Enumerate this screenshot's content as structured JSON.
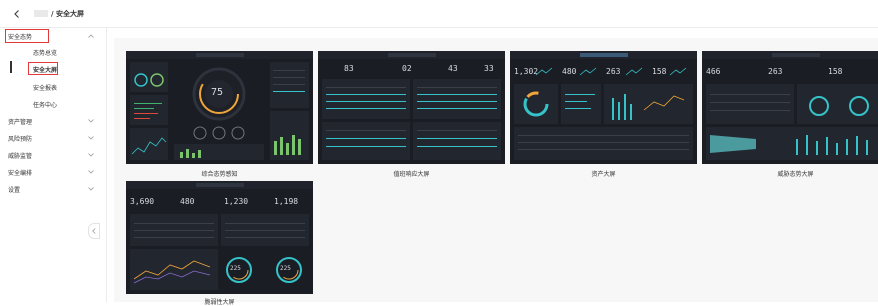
{
  "breadcrumb": {
    "current": "/ 安全大屏"
  },
  "sidebar": {
    "items": [
      {
        "label": "安全态势",
        "expandable": true,
        "expanded": true,
        "selected": true
      },
      {
        "label": "态势总览",
        "sub": true
      },
      {
        "label": "安全大屏",
        "sub": true,
        "active": true
      },
      {
        "label": "安全报表",
        "sub": true
      },
      {
        "label": "任务中心",
        "sub": true
      },
      {
        "label": "资产管理",
        "expandable": true
      },
      {
        "label": "风险预防",
        "expandable": true
      },
      {
        "label": "威胁监管",
        "expandable": true
      },
      {
        "label": "安全编排",
        "expandable": true
      },
      {
        "label": "设置",
        "expandable": true
      }
    ]
  },
  "screens": [
    {
      "label": "综合态势感知",
      "center_value": "75"
    },
    {
      "label": "值班响应大屏",
      "stats": [
        "83",
        "02",
        "43",
        "33"
      ]
    },
    {
      "label": "资产大屏",
      "stats": [
        "1,302",
        "480",
        "263",
        "158"
      ]
    },
    {
      "label": "威胁态势大屏",
      "stats": [
        "466",
        "263",
        "158"
      ]
    },
    {
      "label": "脆弱性大屏",
      "stats": [
        "3,690",
        "480",
        "1,230",
        "1,198"
      ],
      "gauges": [
        "225",
        "225"
      ]
    }
  ],
  "colors": {
    "accent_red": "#e23a3a",
    "teal": "#35c3c9",
    "orange": "#f0a63a",
    "card_bg": "#1a1d23"
  }
}
